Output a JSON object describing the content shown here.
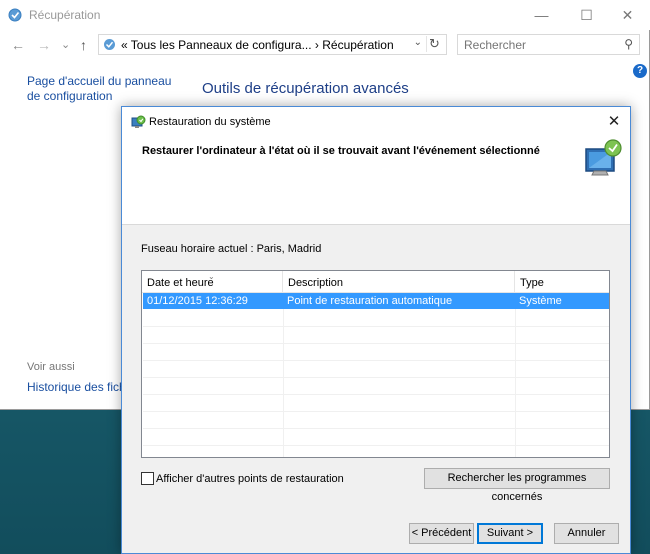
{
  "window": {
    "title": "Récupération",
    "controls": {
      "minimize": "—",
      "maximize": "☐",
      "close": "✕"
    }
  },
  "nav": {
    "back": "←",
    "forward": "→",
    "recent": "⌄",
    "up": "↑",
    "address": "« Tous les Panneaux de configura... › Récupération",
    "address_dropdown": "⌄",
    "refresh": "↻",
    "search_placeholder": "Rechercher"
  },
  "sidebar": {
    "home_link": "Page d'accueil du panneau de configuration",
    "see_also_label": "Voir aussi",
    "history_link": "Historique des fichi"
  },
  "main": {
    "title": "Outils de récupération avancés"
  },
  "dialog": {
    "title": "Restauration du système",
    "heading": "Restaurer l'ordinateur à l'état où il se trouvait avant l'événement sélectionné",
    "timezone": "Fuseau horaire actuel : Paris, Madrid",
    "columns": [
      "Date et heure",
      "Description",
      "Type"
    ],
    "rows": [
      {
        "date": "01/12/2015 12:36:29",
        "description": "Point de restauration automatique",
        "type": "Système"
      }
    ],
    "show_more_label": "Afficher d'autres points de restauration",
    "scan_button": "Rechercher les programmes concernés",
    "prev_button": "< Précédent",
    "next_button": "Suivant >",
    "cancel_button": "Annuler"
  },
  "colors": {
    "selection": "#3399ff",
    "link": "#1a4fa0",
    "title_blue": "#1e3f87",
    "accent": "#0078d7"
  }
}
